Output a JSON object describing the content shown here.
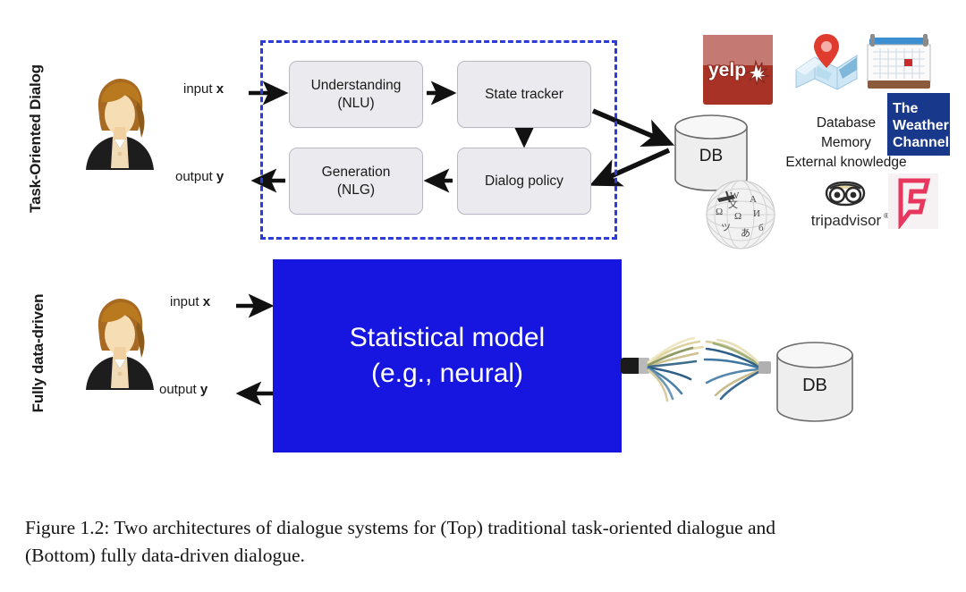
{
  "figure": {
    "caption_line1": "Figure 1.2: Two architectures of dialogue systems for (Top) traditional task-oriented dialogue and",
    "caption_line2": "(Bottom) fully data-driven dialogue."
  },
  "rows": {
    "top_label": "Task-Oriented Dialog",
    "bottom_label": "Fully data-driven"
  },
  "top_architecture": {
    "input_label_text": "input",
    "input_label_var": "x",
    "output_label_text": "output",
    "output_label_var": "y",
    "modules": [
      {
        "id": "nlu",
        "line1": "Understanding",
        "line2": "(NLU)"
      },
      {
        "id": "state_tracker",
        "line1": "State tracker",
        "line2": ""
      },
      {
        "id": "dialog_policy",
        "line1": "Dialog policy",
        "line2": ""
      },
      {
        "id": "nlg",
        "line1": "Generation",
        "line2": "(NLG)"
      }
    ],
    "database_label": "DB",
    "knowledge_lines": [
      "Database",
      "Memory",
      "External knowledge"
    ],
    "logos": [
      {
        "id": "yelp",
        "name": "yelp-logo",
        "text": "yelp"
      },
      {
        "id": "maps",
        "name": "maps-logo",
        "text": ""
      },
      {
        "id": "calendar",
        "name": "calendar-logo",
        "text": ""
      },
      {
        "id": "weather",
        "name": "the-weather-channel-logo",
        "line1": "The",
        "line2": "Weather",
        "line3": "Channel"
      },
      {
        "id": "wikipedia",
        "name": "wikipedia-globe-logo",
        "text": ""
      },
      {
        "id": "tripadvisor",
        "name": "tripadvisor-logo",
        "text": "tripadvisor"
      },
      {
        "id": "foursquare",
        "name": "foursquare-logo",
        "text": ""
      }
    ],
    "dashed_border_color": "#2c3cdb",
    "module_fill_color": "#ebebef"
  },
  "bottom_architecture": {
    "input_label_text": "input",
    "input_label_var": "x",
    "output_label_text": "output",
    "output_label_var": "y",
    "model_line1": "Statistical model",
    "model_line2": "(e.g., neural)",
    "model_color": "#1616e0",
    "database_label": "DB"
  },
  "icons": {
    "avatar": "woman-avatar-icon",
    "database": "database-cylinder-icon",
    "cable": "frayed-network-cable-icon"
  }
}
